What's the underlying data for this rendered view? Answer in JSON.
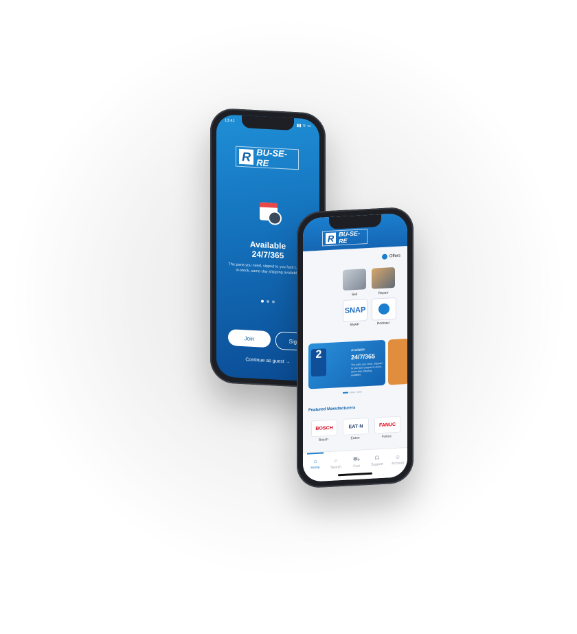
{
  "phone1": {
    "status_time": "13:41",
    "logo_mark": "R",
    "logo_text": "BU-SE-RE",
    "calendar_icon": "calendar-clock-icon",
    "title_line1": "Available",
    "title_line2": "24/7/365",
    "subtitle": "The parts you need, sipped to you fast! Largest in-stock, same-day shipping available.",
    "carousel_dots": 3,
    "carousel_active": 0,
    "join_label": "Join",
    "signin_label": "Sign In",
    "guest_label": "Continue as guest →",
    "accent": "#1470bb"
  },
  "phone2": {
    "logo_mark": "R",
    "logo_text": "BU-SE-RE",
    "offers_label": "Offers",
    "tiles": [
      {
        "label": "Sell"
      },
      {
        "label": "Repair"
      },
      {
        "label": "SNAP"
      },
      {
        "label": "Podcast"
      }
    ],
    "snap_text": "SNAP",
    "banner": {
      "badge_text": "2",
      "label": "Available",
      "title": "24/7/365",
      "body": "The parts you need, shipped to you fast! Largest in-stock, same-day shipping available."
    },
    "featured_title": "Featured Manufacturers",
    "manufacturers": [
      {
        "logo": "BOSCH",
        "label": "Bosch",
        "color": "#d0021b"
      },
      {
        "logo": "EAT·N",
        "label": "Eaton",
        "color": "#1a3a6b"
      },
      {
        "logo": "FANUC",
        "label": "Fanuc",
        "color": "#e3001b"
      }
    ],
    "nav": [
      {
        "label": "Home",
        "icon": "home-icon",
        "active": true
      },
      {
        "label": "Search",
        "icon": "search-icon",
        "active": false
      },
      {
        "label": "Cart",
        "icon": "cart-icon",
        "active": false
      },
      {
        "label": "Support",
        "icon": "headset-icon",
        "active": false
      },
      {
        "label": "Account",
        "icon": "account-icon",
        "active": false
      }
    ]
  }
}
